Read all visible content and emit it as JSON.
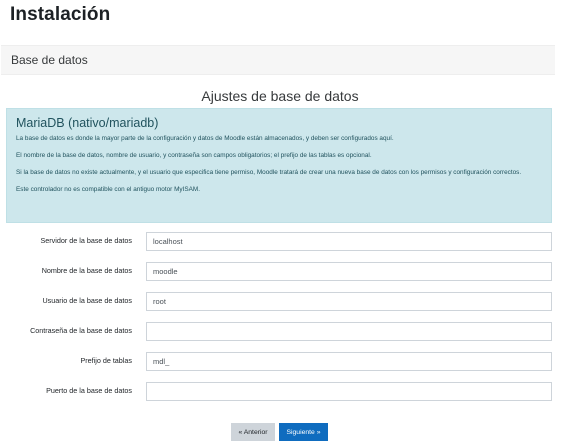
{
  "page": {
    "title": "Instalación"
  },
  "stage": {
    "label": "Base de datos"
  },
  "section": {
    "heading": "Ajustes de base de datos"
  },
  "info": {
    "title": "MariaDB (nativo/mariadb)",
    "paragraphs": [
      "La base de datos es donde la mayor parte de la configuración y datos de Moodle están almacenados, y deben ser configurados aquí.",
      "El nombre de la base de datos, nombre de usuario, y contraseña son campos obligatorios; el prefijo de las tablas es opcional.",
      "Si la base de datos no existe actualmente, y el usuario que especifica tiene permiso, Moodle tratará de crear una nueva base de datos con los permisos y configuración correctos.",
      "Este controlador no es compatible con el antiguo motor MyISAM."
    ]
  },
  "form": {
    "fields": [
      {
        "label": "Servidor de la base de datos",
        "value": "localhost"
      },
      {
        "label": "Nombre de la base de datos",
        "value": "moodle"
      },
      {
        "label": "Usuario de la base de datos",
        "value": "root"
      },
      {
        "label": "Contraseña de la base de datos",
        "value": ""
      },
      {
        "label": "Prefijo de tablas",
        "value": "mdl_"
      },
      {
        "label": "Puerto de la base de datos",
        "value": ""
      }
    ]
  },
  "buttons": {
    "previous": "« Anterior",
    "next": "Siguiente »"
  },
  "colors": {
    "info_background": "#cde7ec",
    "info_text": "#21535e",
    "primary_button": "#0f6cbf",
    "secondary_button": "#ced4da"
  }
}
